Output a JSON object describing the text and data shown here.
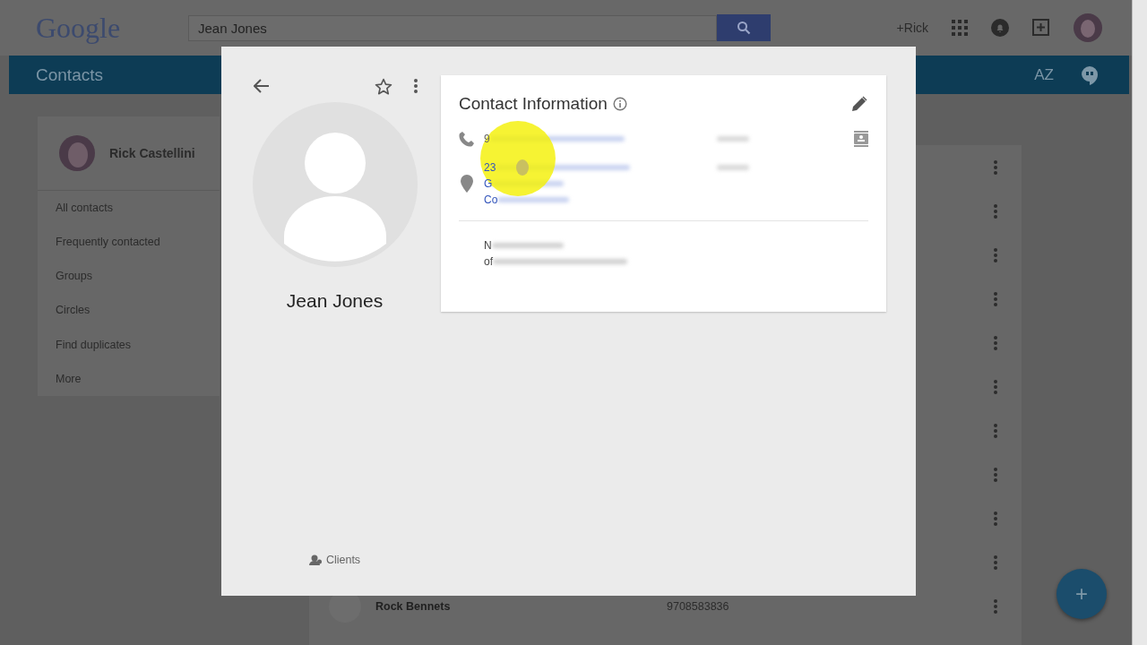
{
  "header": {
    "logo": "Google",
    "search": {
      "value": "Jean Jones"
    },
    "account_link": "+Rick"
  },
  "app_bar": {
    "title": "Contacts",
    "sort_label": "AZ"
  },
  "sidebar": {
    "user_name": "Rick Castellini",
    "items": [
      {
        "label": "All contacts"
      },
      {
        "label": "Frequently contacted"
      },
      {
        "label": "Groups"
      },
      {
        "label": "Circles"
      },
      {
        "label": "Find duplicates"
      },
      {
        "label": "More"
      }
    ]
  },
  "contact_list": {
    "rows": [
      {
        "name": "Rock Bennets",
        "phone": "9708583836"
      }
    ]
  },
  "fab": {
    "label": "+"
  },
  "contact_card": {
    "name": "Jean Jones",
    "group": "Clients",
    "info": {
      "title": "Contact Information",
      "entries": [
        {
          "kind": "phone",
          "lines": [
            "9"
          ]
        },
        {
          "kind": "address",
          "lines": [
            "23",
            "G",
            "Co"
          ]
        }
      ],
      "notes": [
        "N",
        "of"
      ]
    }
  }
}
